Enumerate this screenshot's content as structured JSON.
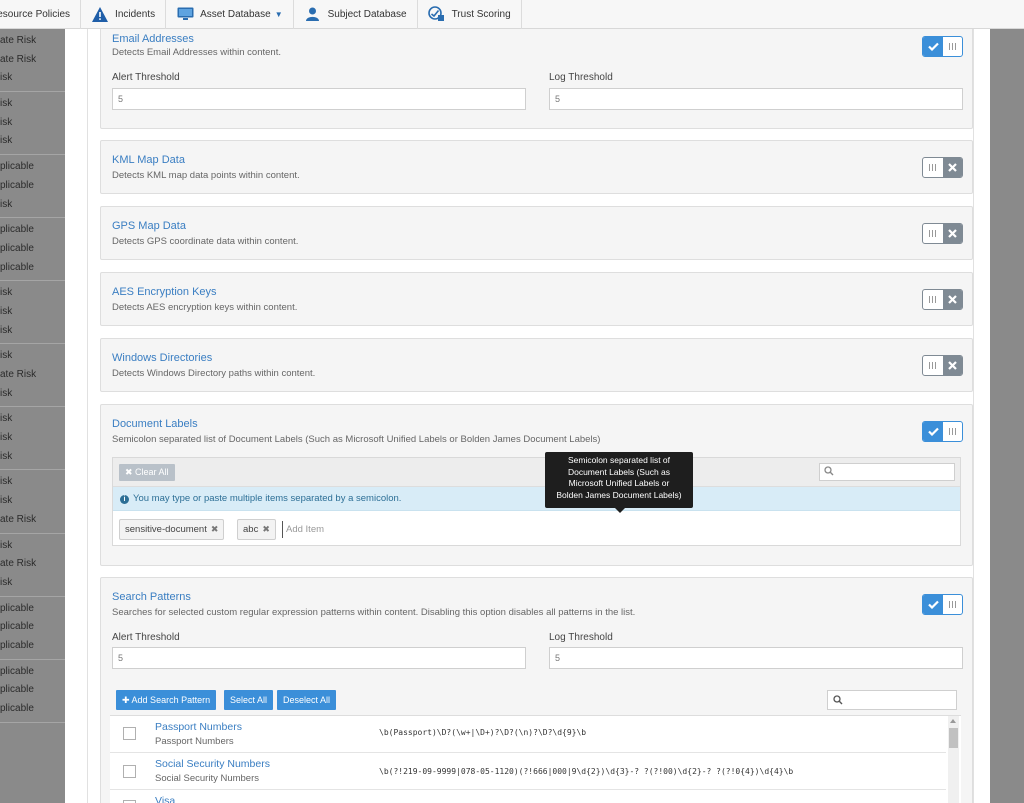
{
  "nav": {
    "items": [
      {
        "label": "Resource Policies",
        "icon": "none"
      },
      {
        "label": "Incidents",
        "icon": "warning-triangle-icon"
      },
      {
        "label": "Asset Database",
        "icon": "monitor-icon",
        "dropdown": true
      },
      {
        "label": "Subject Database",
        "icon": "person-icon"
      },
      {
        "label": "Trust Scoring",
        "icon": "trust-score-icon"
      }
    ]
  },
  "left_list": {
    "groups": [
      [
        "ate Risk",
        "ate Risk",
        "isk"
      ],
      [
        "isk",
        "isk",
        "isk"
      ],
      [
        "plicable",
        "plicable",
        "isk"
      ],
      [
        "plicable",
        "plicable",
        "plicable"
      ],
      [
        "isk",
        "isk",
        "isk"
      ],
      [
        "isk",
        "ate Risk",
        "isk"
      ],
      [
        "isk",
        "isk",
        "isk"
      ],
      [
        "isk",
        "isk",
        "ate Risk"
      ],
      [
        "isk",
        "ate Risk",
        "isk"
      ],
      [
        "plicable",
        "plicable",
        "plicable"
      ],
      [
        "plicable",
        "plicable",
        "plicable"
      ]
    ]
  },
  "email": {
    "title": "Email Addresses",
    "desc": "Detects Email Addresses within content.",
    "alert_label": "Alert Threshold",
    "alert_value": "5",
    "log_label": "Log Threshold",
    "log_value": "5",
    "enabled": true
  },
  "kml": {
    "title": "KML Map Data",
    "desc": "Detects KML map data points within content.",
    "enabled": false
  },
  "gps": {
    "title": "GPS Map Data",
    "desc": "Detects GPS coordinate data within content.",
    "enabled": false
  },
  "aes": {
    "title": "AES Encryption Keys",
    "desc": "Detects AES encryption keys within content.",
    "enabled": false
  },
  "windirs": {
    "title": "Windows Directories",
    "desc": "Detects Windows Directory paths within content.",
    "enabled": false
  },
  "doclabels": {
    "title": "Document Labels",
    "desc": "Semicolon separated list of Document Labels (Such as Microsoft Unified Labels or Bolden James Document Labels)",
    "enabled": true,
    "clear_label": "Clear All",
    "info": "You may type or paste multiple items separated by a semicolon.",
    "tags": [
      "sensitive-document",
      "abc"
    ],
    "add_placeholder": "Add Item",
    "tooltip": [
      "Semicolon separated list of",
      "Document Labels (Such as",
      "Microsoft Unified Labels or",
      "Bolden James Document Labels)"
    ]
  },
  "search_patterns": {
    "title": "Search Patterns",
    "desc": "Searches for selected custom regular expression patterns within content. Disabling this option disables all patterns in the list.",
    "enabled": true,
    "alert_label": "Alert Threshold",
    "alert_value": "5",
    "log_label": "Log Threshold",
    "log_value": "5",
    "add_button": "Add Search Pattern",
    "select_all": "Select All",
    "deselect_all": "Deselect All",
    "rows": [
      {
        "name": "Passport Numbers",
        "sub": "Passport Numbers",
        "regex": "\\b(Passport)\\D?(\\w+|\\D+)?\\D?(\\n)?\\D?\\d{9}\\b"
      },
      {
        "name": "Social Security Numbers",
        "sub": "Social Security Numbers",
        "regex": "\\b(?!219-09-9999|078-05-1120)(?!666|000|9\\d{2})\\d{3}-? ?(?!00)\\d{2}-? ?(?!0{4})\\d{4}\\b"
      },
      {
        "name": "Visa",
        "sub": "",
        "regex": ""
      }
    ]
  },
  "colors": {
    "accent": "#3b8fd9",
    "link": "#3a7ec2",
    "off": "#7f8a94",
    "info_bg": "#d8ecf7"
  }
}
